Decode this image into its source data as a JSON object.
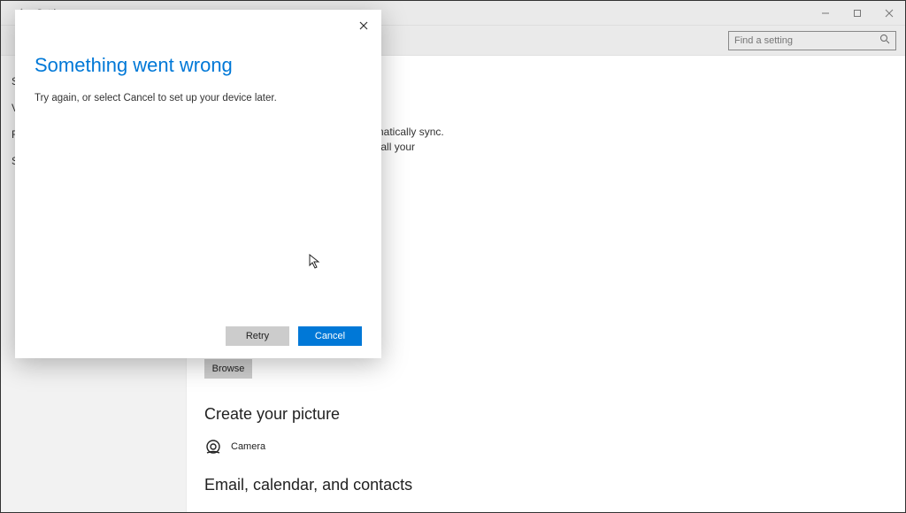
{
  "window": {
    "title": "Settings"
  },
  "header": {
    "search_placeholder": "Find a setting"
  },
  "sidebar": {
    "items": [
      {
        "label": "S"
      },
      {
        "label": "V"
      },
      {
        "label": "F"
      },
      {
        "label": "S"
      }
    ]
  },
  "main": {
    "sync_text_partial_1": "utomatically sync.",
    "sync_text_partial_2": "f on all your",
    "browse_label": "Browse",
    "create_picture_heading": "Create your picture",
    "camera_label": "Camera",
    "email_heading": "Email, calendar, and contacts"
  },
  "dialog": {
    "title": "Something went wrong",
    "body": "Try again, or select Cancel to set up your device later.",
    "retry_label": "Retry",
    "cancel_label": "Cancel"
  }
}
